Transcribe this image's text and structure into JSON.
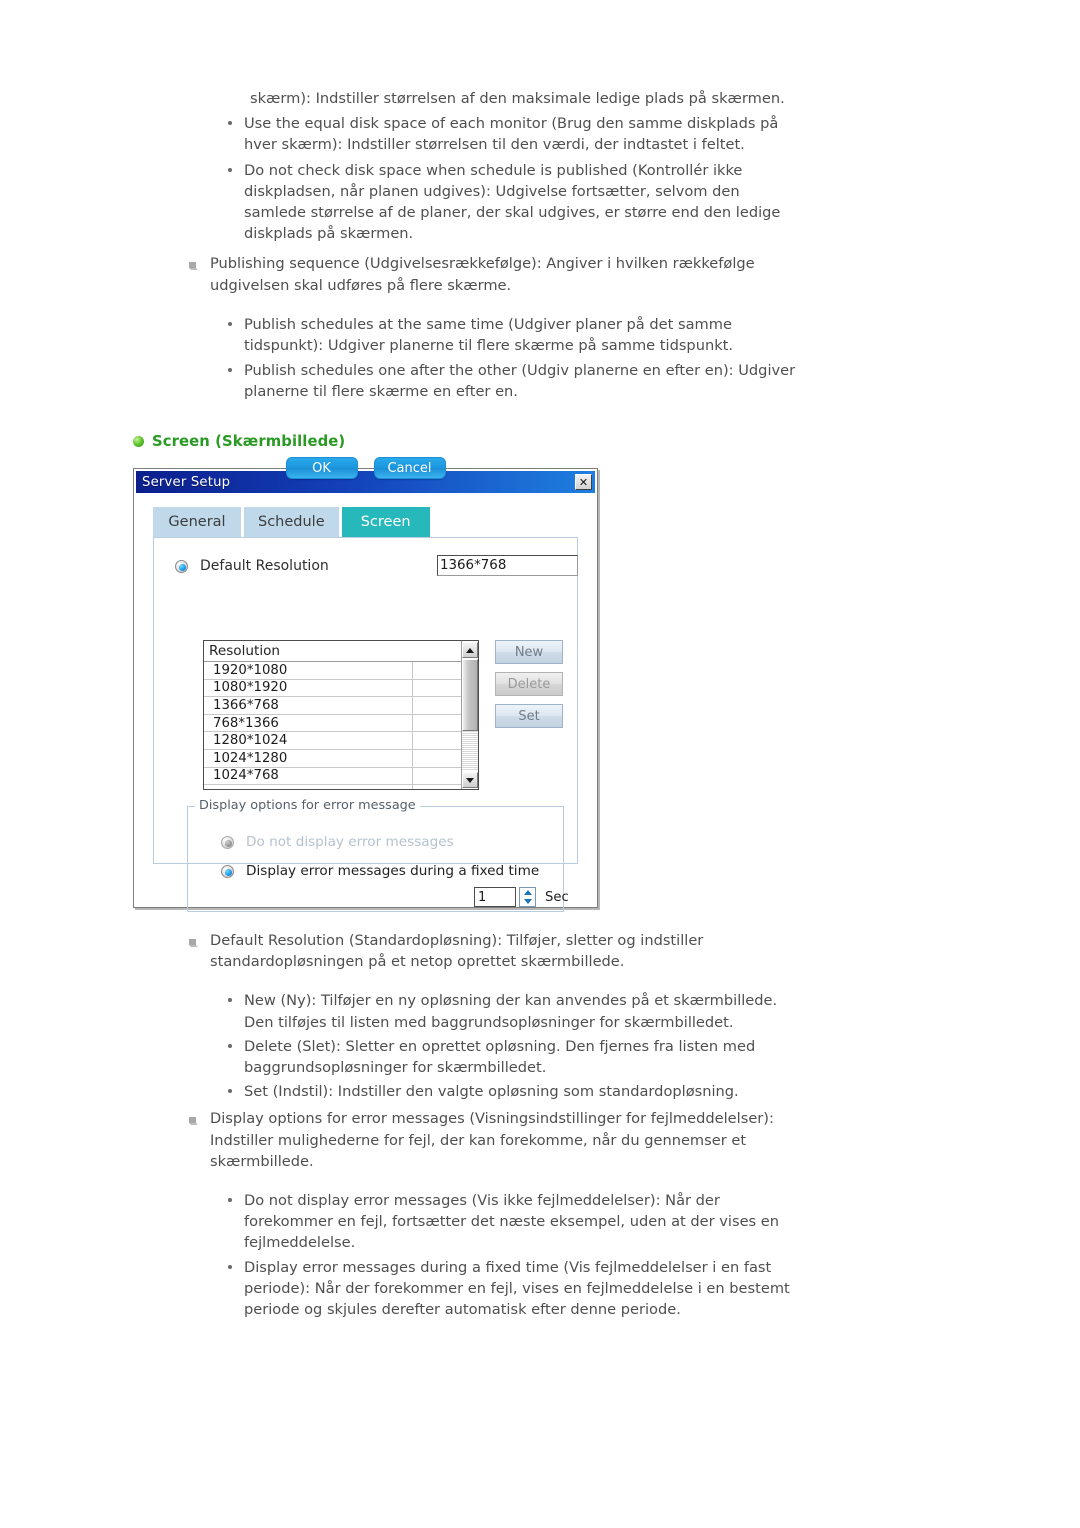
{
  "top_text": {
    "lead_cont": "skærm): Indstiller størrelsen af den maksimale ledige plads på skærmen.",
    "bullets_1": [
      "Use the equal disk space of each monitor (Brug den samme diskplads på hver skærm): Indstiller størrelsen til den værdi, der indtastet i feltet.",
      "Do not check disk space when schedule is published (Kontrollér ikke diskpladsen, når planen udgives): Udgivelse fortsætter, selvom den samlede størrelse af de planer, der skal udgives, er større end den ledige diskplads på skærmen."
    ],
    "item_publishing": "Publishing sequence (Udgivelsesrækkefølge): Angiver i hvilken rækkefølge udgivelsen skal udføres på flere skærme.",
    "bullets_2": [
      "Publish schedules at the same time (Udgiver planer på det samme tidspunkt): Udgiver planerne til flere skærme på samme tidspunkt.",
      "Publish schedules one after the other (Udgiv planerne en efter en): Udgiver planerne til flere skærme en efter en."
    ]
  },
  "section": {
    "heading": "Screen (Skærmbillede)",
    "bullet_icon": "green-lamp-icon"
  },
  "dialog": {
    "title": "Server Setup",
    "close_icon": "close-icon",
    "tabs": [
      {
        "label": "General",
        "active": false
      },
      {
        "label": "Schedule",
        "active": false
      },
      {
        "label": "Screen",
        "active": true
      }
    ],
    "default_resolution": {
      "label": "Default Resolution",
      "selected": true,
      "value": "1366*768"
    },
    "list": {
      "column_header": "Resolution",
      "rows": [
        "1920*1080",
        "1080*1920",
        "1366*768",
        "768*1366",
        "1280*1024",
        "1024*1280",
        "1024*768"
      ],
      "scroll_up_icon": "triangle-up-icon",
      "scroll_down_icon": "triangle-down-icon"
    },
    "side_buttons": [
      {
        "label": "New",
        "disabled": false
      },
      {
        "label": "Delete",
        "disabled": true
      },
      {
        "label": "Set",
        "disabled": false
      }
    ],
    "error_group": {
      "legend": "Display options for error message",
      "option_none": {
        "label": "Do not display error messages",
        "selected": false,
        "disabled": true
      },
      "option_fixed": {
        "label": "Display error messages during a fixed time",
        "selected": true,
        "disabled": false
      },
      "spinner": {
        "value": "1",
        "unit": "Sec",
        "up_icon": "spinner-up-icon",
        "down_icon": "spinner-down-icon"
      }
    },
    "footer": {
      "ok": "OK",
      "cancel": "Cancel"
    }
  },
  "bottom_text": {
    "item_default_resolution": "Default Resolution (Standardopløsning): Tilføjer, sletter og indstiller standardopløsningen på et netop oprettet skærmbillede.",
    "bullets_3": [
      "New (Ny): Tilføjer en ny opløsning der kan anvendes på et skærmbillede. Den tilføjes til listen med baggrundsopløsninger for skærmbilledet.",
      "Delete (Slet): Sletter en oprettet opløsning. Den fjernes fra listen med baggrundsopløsninger for skærmbilledet.",
      "Set (Indstil): Indstiller den valgte opløsning som standardopløsning."
    ],
    "item_display_options": "Display options for error messages (Visningsindstillinger for fejlmeddelelser): Indstiller mulighederne for fejl, der kan forekomme, når du gennemser et skærmbillede.",
    "bullets_4": [
      "Do not display error messages (Vis ikke fejlmeddelelser): Når der forekommer en fejl, fortsætter det næste eksempel, uden at der vises en fejlmeddelelse.",
      "Display error messages during a fixed time (Vis fejlmeddelelser i en fast periode): Når der forekommer en fejl, vises en fejlmeddelelse i en bestemt periode og skjules derefter automatisk efter denne periode."
    ]
  }
}
